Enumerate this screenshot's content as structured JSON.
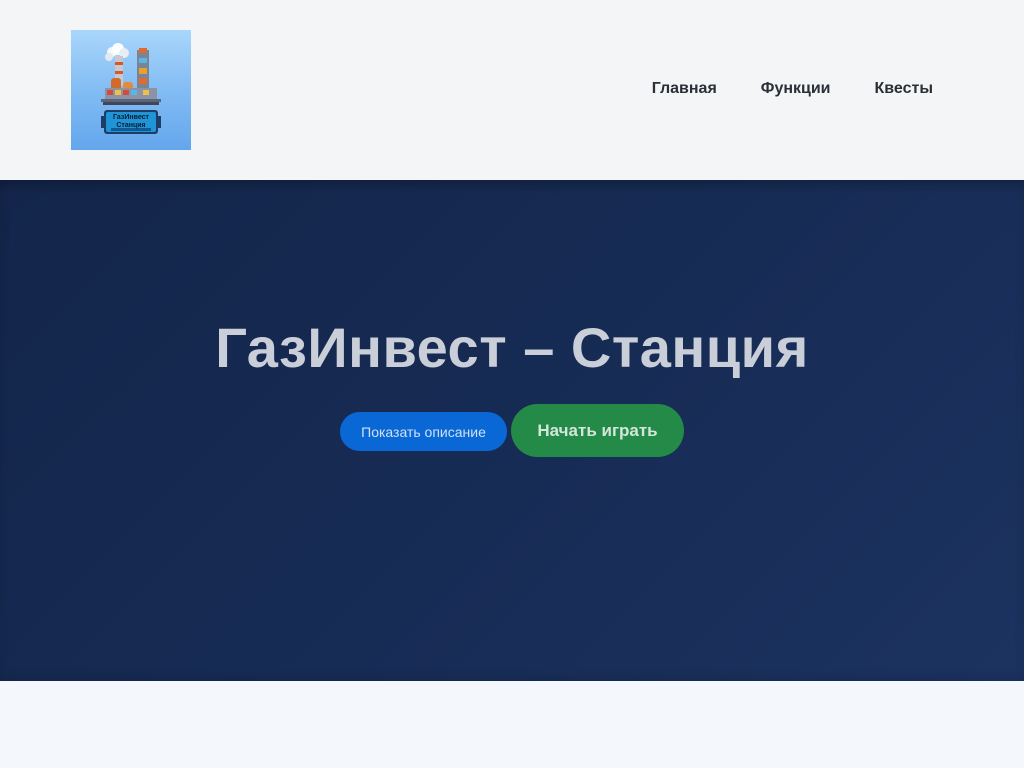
{
  "header": {
    "logo": {
      "caption_line1": "ГазИнвест",
      "caption_line2": "Станция",
      "background_color": "#7fbaf3"
    },
    "nav": [
      {
        "label": "Главная"
      },
      {
        "label": "Функции"
      },
      {
        "label": "Квесты"
      }
    ]
  },
  "hero": {
    "title": "ГазИнвест – Станция",
    "description_button": "Показать описание",
    "play_button": "Начать играть",
    "background_color": "#172c55",
    "description_button_color": "#0a68d6",
    "play_button_color": "#238b47"
  }
}
